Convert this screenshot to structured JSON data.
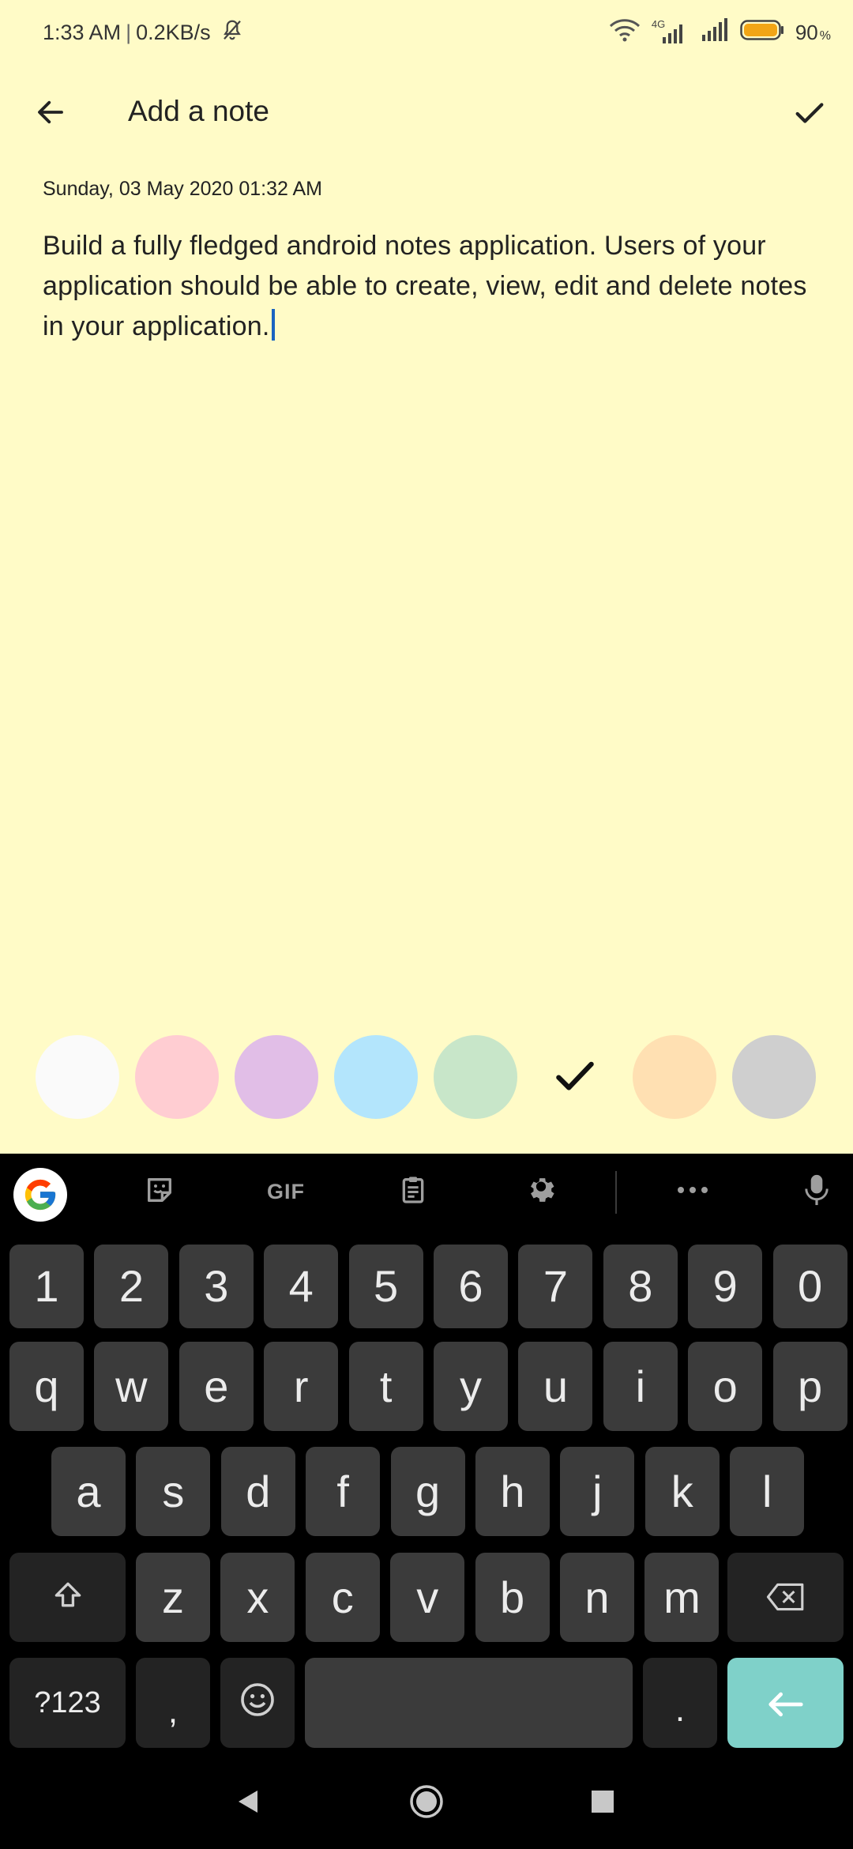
{
  "status_bar": {
    "time": "1:33 AM",
    "separator": "|",
    "speed": "0.2KB/s",
    "network_label": "4G",
    "battery_value": "90",
    "battery_unit": "%"
  },
  "app_bar": {
    "title": "Add a note"
  },
  "note": {
    "date": "Sunday, 03 May 2020 01:32 AM",
    "body": "Build a fully fledged android notes application. Users of your application should be able to create, view, edit and delete notes in your application."
  },
  "color_picker": {
    "colors": [
      "#fafafa",
      "#ffcdd2",
      "#e1bee7",
      "#b3e5fc",
      "#c8e6c9",
      "#fffbc7",
      "#ffe0b2",
      "#cfcfcf"
    ],
    "selected_index": 5
  },
  "keyboard": {
    "toolbar": {
      "gif_label": "GIF"
    },
    "row_numbers": [
      "1",
      "2",
      "3",
      "4",
      "5",
      "6",
      "7",
      "8",
      "9",
      "0"
    ],
    "row_1": [
      "q",
      "w",
      "e",
      "r",
      "t",
      "y",
      "u",
      "i",
      "o",
      "p"
    ],
    "row_2": [
      "a",
      "s",
      "d",
      "f",
      "g",
      "h",
      "j",
      "k",
      "l"
    ],
    "row_3": [
      "z",
      "x",
      "c",
      "v",
      "b",
      "n",
      "m"
    ],
    "symbols_label": "?123",
    "comma_label": ",",
    "period_label": ".",
    "accent_color": "#7fd1c9"
  }
}
